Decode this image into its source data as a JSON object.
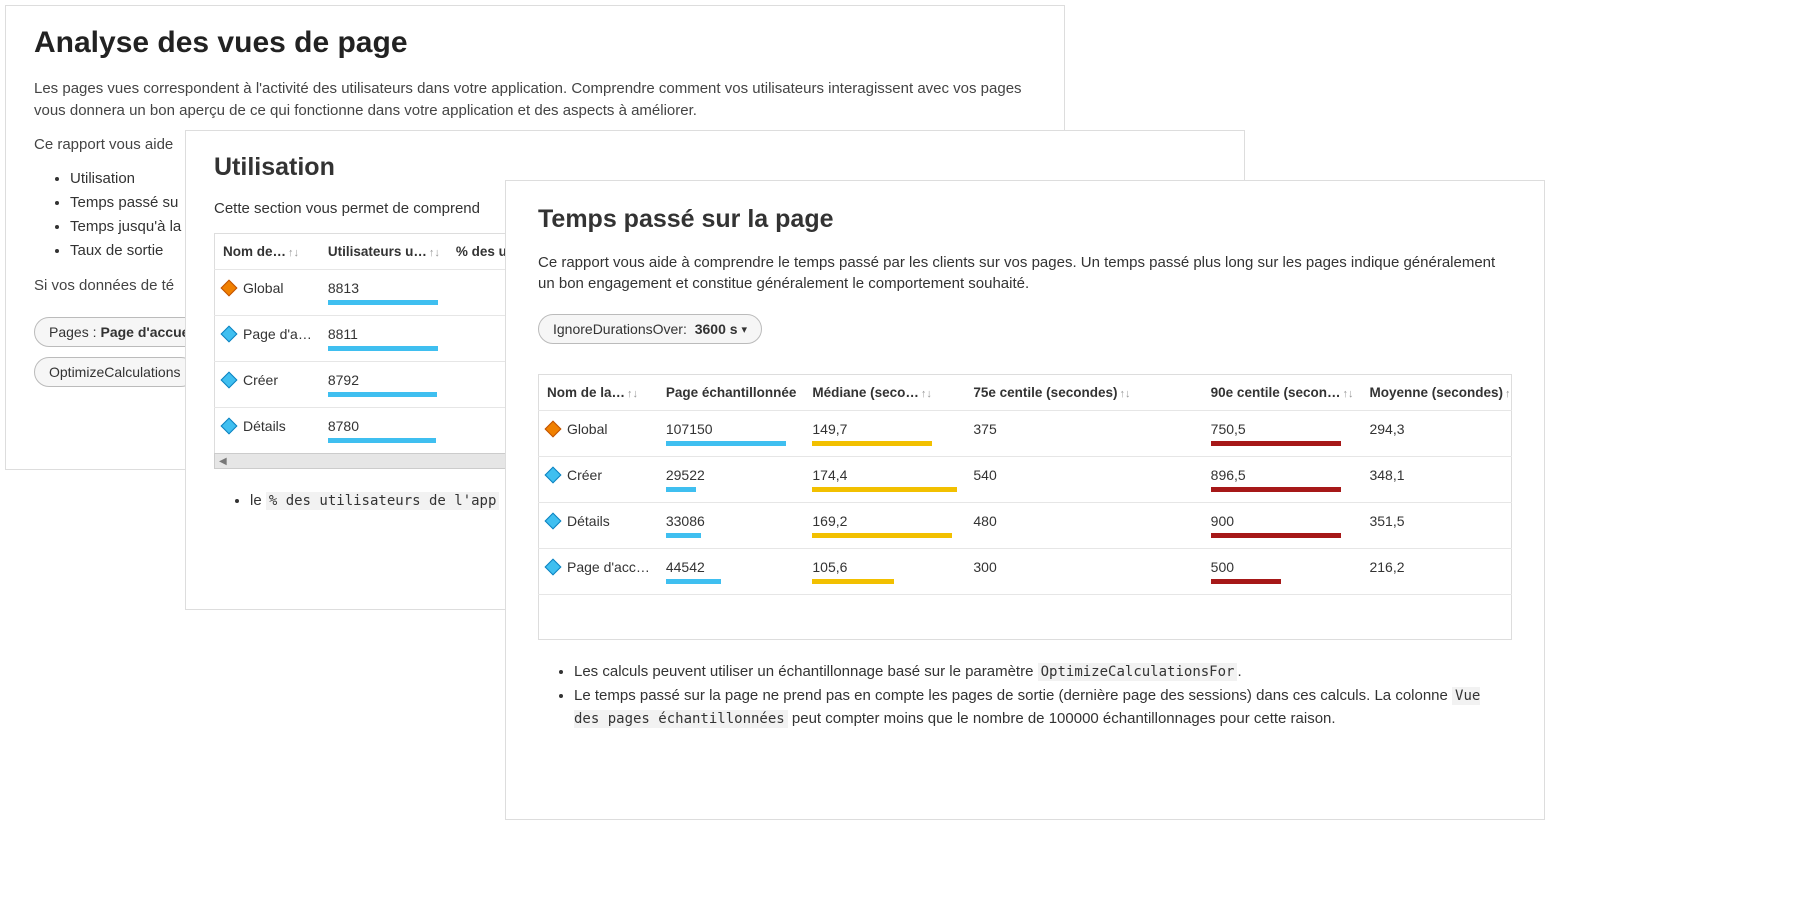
{
  "main": {
    "title": "Analyse des vues de page",
    "intro": "Les pages vues correspondent à l'activité des utilisateurs dans votre application. Comprendre comment vos utilisateurs interagissent avec vos pages vous donnera un bon aperçu de ce qui fonctionne dans votre application et des aspects à améliorer.",
    "lead": "Ce rapport vous aide",
    "bullets": [
      "Utilisation",
      "Temps passé su",
      "Temps jusqu'à la",
      "Taux de sortie"
    ],
    "tele": "Si vos données de té",
    "pill1_label": "Pages :",
    "pill1_value": "Page d'accue",
    "pill2": "OptimizeCalculations"
  },
  "util": {
    "title": "Utilisation",
    "intro": "Cette section vous permet de comprend",
    "headers": {
      "name": "Nom de…",
      "users": "Utilisateurs u…",
      "pct": "% des u"
    },
    "rows": [
      {
        "name": "Global",
        "users": "8813",
        "icon": "orange",
        "bar": 110
      },
      {
        "name": "Page d'a…",
        "users": "8811",
        "icon": "blue",
        "bar": 110
      },
      {
        "name": "Créer",
        "users": "8792",
        "icon": "blue",
        "bar": 109
      },
      {
        "name": "Détails",
        "users": "8780",
        "icon": "blue",
        "bar": 108
      }
    ],
    "note_prefix": "le ",
    "note_code": "% des utilisateurs de l'app"
  },
  "time": {
    "title": "Temps passé sur la page",
    "intro": "Ce rapport vous aide à comprendre le temps passé par les clients sur vos pages. Un temps passé plus long sur les pages indique généralement un bon engagement et constitue généralement le comportement souhaité.",
    "pill_label": "IgnoreDurationsOver:",
    "pill_value": "3600 s",
    "headers": {
      "name": "Nom de la…",
      "samp": "Page échantillonnée",
      "med": "Médiane (seco…",
      "p75": "75e centile (secondes)",
      "p90": "90e centile (secon…",
      "avg": "Moyenne (secondes)"
    },
    "rows": [
      {
        "name": "Global",
        "icon": "orange",
        "samp": "107150",
        "samp_bar": 120,
        "med": "149,7",
        "med_bar": 120,
        "p75": "375",
        "p90": "750,5",
        "p90_bar": 130,
        "avg": "294,3"
      },
      {
        "name": "Créer",
        "icon": "blue",
        "samp": "29522",
        "samp_bar": 30,
        "med": "174,4",
        "med_bar": 145,
        "p75": "540",
        "p90": "896,5",
        "p90_bar": 130,
        "avg": "348,1"
      },
      {
        "name": "Détails",
        "icon": "blue",
        "samp": "33086",
        "samp_bar": 35,
        "med": "169,2",
        "med_bar": 140,
        "p75": "480",
        "p90": "900",
        "p90_bar": 130,
        "avg": "351,5"
      },
      {
        "name": "Page d'acc…",
        "icon": "blue",
        "samp": "44542",
        "samp_bar": 55,
        "med": "105,6",
        "med_bar": 82,
        "p75": "300",
        "p90": "500",
        "p90_bar": 70,
        "avg": "216,2"
      }
    ],
    "notes": {
      "n1a": "Les calculs peuvent utiliser un échantillonnage basé sur le paramètre ",
      "n1b": "OptimizeCalculationsFor",
      "n1c": ".",
      "n2a": "Le temps passé sur la page ne prend pas en compte les pages de sortie (dernière page des sessions) dans ces calculs. La colonne ",
      "n2b": "Vue des pages échantillonnées",
      "n2c": " peut compter moins que le nombre de 100000 échantillonnages pour cette raison."
    }
  },
  "chart_data": [
    {
      "type": "table",
      "title": "Utilisation",
      "columns": [
        "Nom",
        "Utilisateurs uniques"
      ],
      "rows": [
        [
          "Global",
          8813
        ],
        [
          "Page d'accueil",
          8811
        ],
        [
          "Créer",
          8792
        ],
        [
          "Détails",
          8780
        ]
      ]
    },
    {
      "type": "table",
      "title": "Temps passé sur la page",
      "columns": [
        "Nom",
        "Page échantillonnée",
        "Médiane (s)",
        "75e centile (s)",
        "90e centile (s)",
        "Moyenne (s)"
      ],
      "rows": [
        [
          "Global",
          107150,
          149.7,
          375,
          750.5,
          294.3
        ],
        [
          "Créer",
          29522,
          174.4,
          540,
          896.5,
          348.1
        ],
        [
          "Détails",
          33086,
          169.2,
          480,
          900,
          351.5
        ],
        [
          "Page d'accueil",
          44542,
          105.6,
          300,
          500,
          216.2
        ]
      ]
    }
  ]
}
